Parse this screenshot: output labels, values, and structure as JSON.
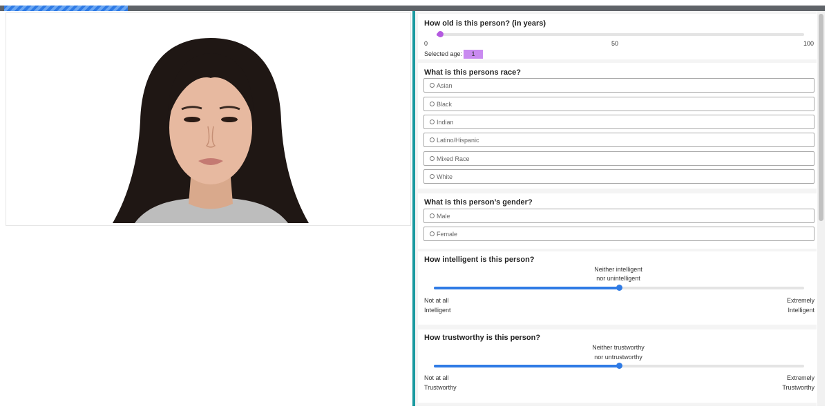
{
  "progress": {
    "fraction": 0.15
  },
  "age_question": {
    "title": "How old is this person? (in years)",
    "min_label": "0",
    "mid_label": "50",
    "max_label": "100",
    "min": 0,
    "max": 100,
    "value": 1,
    "selected_prefix": "Selected age:",
    "selected_value": "1",
    "accent_color": "#b45ae0"
  },
  "race_question": {
    "title": "What is this persons race?",
    "options": [
      "Asian",
      "Black",
      "Indian",
      "Latino/Hispanic",
      "Mixed Race",
      "White"
    ]
  },
  "gender_question": {
    "title": "What is this person’s gender?",
    "options": [
      "Male",
      "Female"
    ]
  },
  "intelligence_question": {
    "title": "How intelligent is this person?",
    "center_label_line1": "Neither intelligent",
    "center_label_line2": "nor unintelligent",
    "left_label_line1": "Not at all",
    "left_label_line2": "Intelligent",
    "right_label_line1": "Extremely",
    "right_label_line2": "Intelligent",
    "value_fraction": 0.5,
    "accent_color": "#2f7be5"
  },
  "trust_question": {
    "title": "How trustworthy is this person?",
    "center_label_line1": "Neither trustworthy",
    "center_label_line2": "nor untrustworthy",
    "left_label_line1": "Not at all",
    "left_label_line2": "Trustworthy",
    "right_label_line1": "Extremely",
    "right_label_line2": "Trustworthy",
    "value_fraction": 0.5,
    "accent_color": "#2f7be5"
  }
}
